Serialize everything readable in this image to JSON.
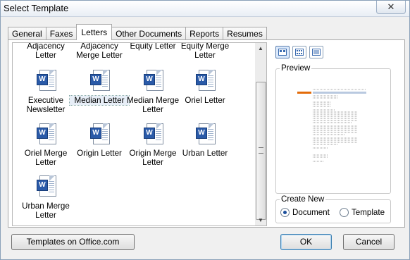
{
  "window": {
    "title": "Select Template",
    "close_glyph": "✕"
  },
  "tabs": [
    {
      "label": "General"
    },
    {
      "label": "Faxes"
    },
    {
      "label": "Letters",
      "active": true
    },
    {
      "label": "Other Documents"
    },
    {
      "label": "Reports"
    },
    {
      "label": "Resumes"
    }
  ],
  "templates": [
    {
      "label": "Adjacency Letter"
    },
    {
      "label": "Adjacency Merge Letter"
    },
    {
      "label": "Equity Letter"
    },
    {
      "label": "Equity Merge Letter"
    },
    {
      "label": "Executive Newsletter"
    },
    {
      "label": "Median Letter",
      "selected": true
    },
    {
      "label": "Median Merge Letter"
    },
    {
      "label": "Oriel Letter"
    },
    {
      "label": "Oriel Merge Letter"
    },
    {
      "label": "Origin Letter"
    },
    {
      "label": "Origin Merge Letter"
    },
    {
      "label": "Urban Letter"
    },
    {
      "label": "Urban Merge Letter"
    }
  ],
  "icons": {
    "template": "word-document-icon",
    "badge_letter": "W"
  },
  "view_buttons": [
    {
      "name": "large-icons-view-icon",
      "active": true
    },
    {
      "name": "list-view-icon"
    },
    {
      "name": "details-view-icon"
    }
  ],
  "preview": {
    "label": "Preview"
  },
  "create_new": {
    "label": "Create New",
    "options": [
      {
        "label": "Document",
        "selected": true
      },
      {
        "label": "Template",
        "selected": false
      }
    ]
  },
  "buttons": {
    "office": "Templates on Office.com",
    "ok": "OK",
    "cancel": "Cancel"
  },
  "colors": {
    "preview_accent": "#e36c0a",
    "word_badge": "#2a5aa8"
  }
}
